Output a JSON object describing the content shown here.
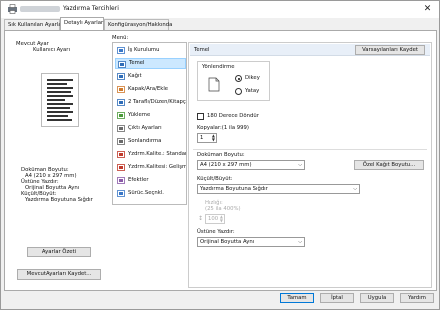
{
  "window": {
    "title": "Yazdırma Tercihleri",
    "close_glyph": "✕"
  },
  "tabs": [
    {
      "label": "Sık Kullanılan Ayarlar"
    },
    {
      "label": "Detaylı Ayarlar"
    },
    {
      "label": "Konfigürasyon/Hakkında"
    }
  ],
  "left": {
    "heading": "Mevcut Ayar",
    "subheading": "Kullanıcı Ayarı",
    "info": [
      "Doküman Boyutu:",
      "A4 (210 x 297 mm)",
      "Üstüne Yazdır:",
      "Orijinal Boyutta Aynı",
      "Küçült/Büyüt:",
      "Yazdırma Boyutuna Sığdır"
    ],
    "summary_button": "Ayarlar Özeti",
    "save_button": "MevcutAyarları Kaydet..."
  },
  "menu": {
    "label": "Menü:",
    "items": [
      {
        "label": "İş Kurulumu",
        "icon": "job-setup-icon"
      },
      {
        "label": "Temel",
        "icon": "basic-icon"
      },
      {
        "label": "Kağıt",
        "icon": "paper-icon"
      },
      {
        "label": "Kapak/Ara/Ekle",
        "icon": "cover-icon"
      },
      {
        "label": "2 Taraflı/Düzen/Kitapçık",
        "icon": "duplex-icon"
      },
      {
        "label": "Yükleme",
        "icon": "layout-icon"
      },
      {
        "label": "Çıktı Ayarları",
        "icon": "output-icon"
      },
      {
        "label": "Sonlandırma",
        "icon": "finishing-icon"
      },
      {
        "label": "Yzdrm.Kalite.: Standart",
        "icon": "quality-icon"
      },
      {
        "label": "Yzdrm.Kalitesi: Gelişmiş",
        "icon": "quality-advanced-icon"
      },
      {
        "label": "Efektler",
        "icon": "effects-icon"
      },
      {
        "label": "Sürüc.Seçnkl.",
        "icon": "driver-options-icon"
      }
    ],
    "selected_index": 1
  },
  "panel": {
    "title": "Temel",
    "default_button": "Varsayılanları Kaydet",
    "orientation": {
      "label": "Yönlendirme",
      "options": [
        "Dikey",
        "Yatay"
      ],
      "selected": "Dikey"
    },
    "rotate_label": "180 Derece Döndür",
    "copies": {
      "label": "Kopyalar:(1 ila 999)",
      "value": "1"
    },
    "doc_size": {
      "label": "Doküman Boyutu:",
      "value": "A4 (210 x 297 mm)",
      "custom_button": "Özel Kağıt Boyutu..."
    },
    "scale": {
      "label": "Küçült/Büyüt:",
      "value": "Yazdırma Boyutuna Sığdır"
    },
    "ratio": {
      "label": "Hızlığı:",
      "range": "(25 ila 400%)",
      "value": "100"
    },
    "overlay": {
      "label": "Üstüne Yazdır:",
      "value": "Orijinal Boyutta Aynı"
    }
  },
  "footer": {
    "ok": "Tamam",
    "cancel": "İptal",
    "apply": "Uygula",
    "help": "Yardım"
  },
  "colors": {
    "selected_bg": "#cce8ff",
    "header_bg": "#e8eff8",
    "accent": "#0078d7"
  }
}
